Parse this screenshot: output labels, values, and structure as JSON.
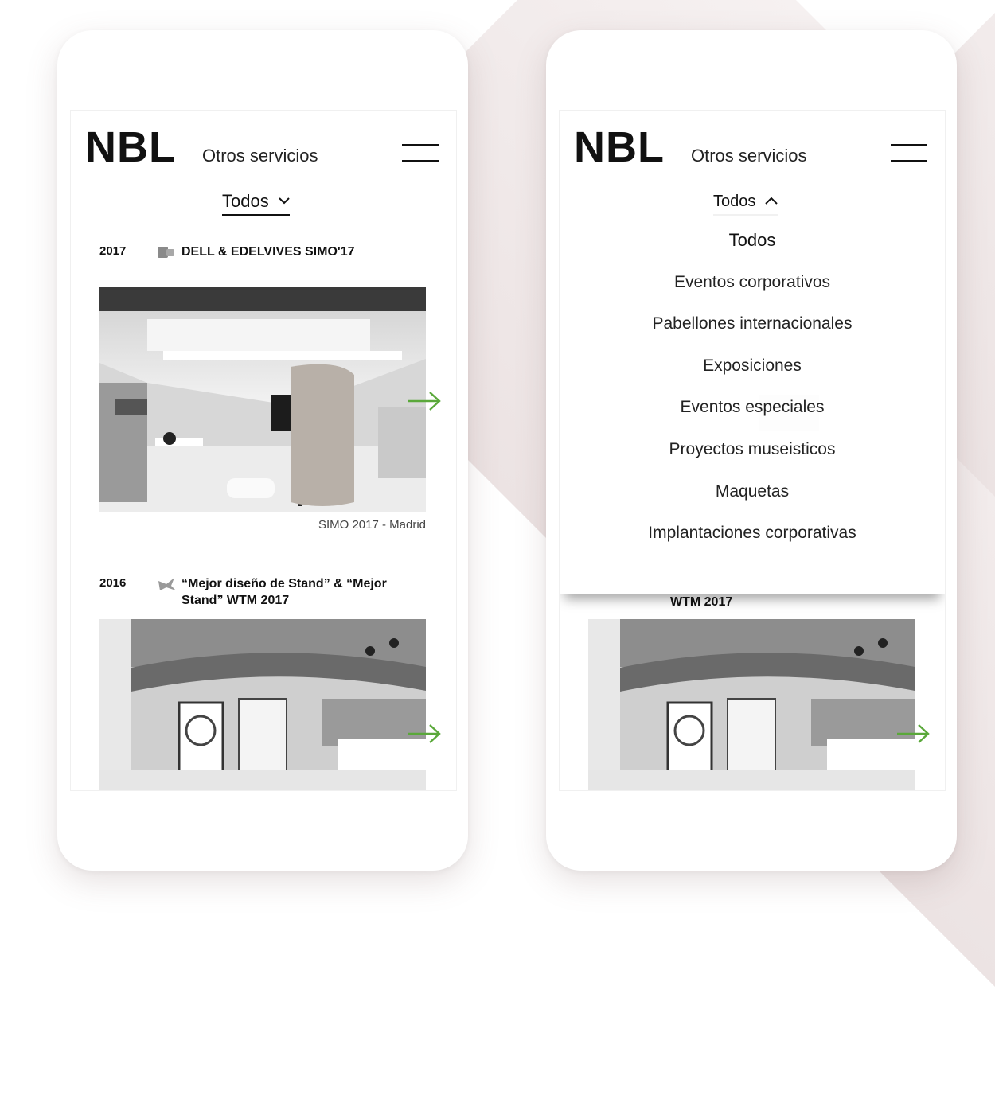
{
  "phones": [
    {
      "header": {
        "logo": "NBL",
        "service": "Otros servicios"
      },
      "filter": {
        "label": "Todos",
        "chevron": "⌄"
      },
      "entries": [
        {
          "year": "2017",
          "icon": "briefcase-icon",
          "title": "DELL & EDELVIVES SIMO'17",
          "caption": "SIMO 2017 - Madrid"
        },
        {
          "year": "2016",
          "icon": "award-icon",
          "title": "“Mejor diseño de Stand” & “Mejor Stand” WTM 2017"
        }
      ]
    },
    {
      "header": {
        "logo": "NBL",
        "service": "Otros servicios"
      },
      "filter": {
        "label": "Todos",
        "chevron": "^"
      },
      "dropdown": [
        "Todos",
        "Eventos corporativos",
        "Pabellones internacionales",
        "Exposiciones",
        "Eventos especiales",
        "Proyectos museisticos",
        "Maquetas",
        "Implantaciones corporativas"
      ],
      "visible_under_menu": "WTM 2017"
    }
  ],
  "colors": {
    "accent_arrow": "#5aa83a",
    "text": "#111111",
    "background": "#ffffff",
    "decor": "#ece3e3"
  }
}
